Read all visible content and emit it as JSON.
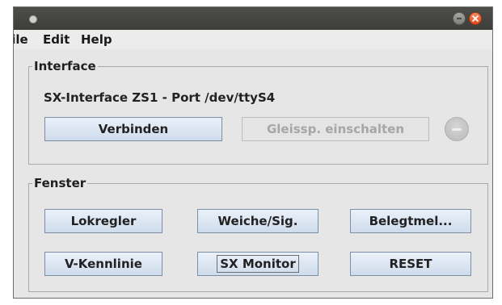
{
  "menu": {
    "file": "File",
    "edit": "Edit",
    "help": "Help"
  },
  "interface": {
    "title": "Interface",
    "status_text": "SX-Interface ZS1 - Port /dev/ttyS4",
    "connect_label": "Verbinden",
    "power_label": "Gleissp. einschalten",
    "power_enabled": false,
    "status_icon": "no-entry-icon"
  },
  "fenster": {
    "title": "Fenster",
    "buttons": {
      "lokregler": "Lokregler",
      "weiche": "Weiche/Sig.",
      "belegtmel": "Belegtmel...",
      "vkennlinie": "V-Kennlinie",
      "sxmonitor": "SX Monitor",
      "reset": "RESET"
    }
  },
  "colors": {
    "titlebar": "#45453f",
    "window_bg": "#e6e6e6",
    "button_top": "#eaf1fa",
    "button_bottom": "#cfdcec",
    "close_button": "#e8572a"
  }
}
